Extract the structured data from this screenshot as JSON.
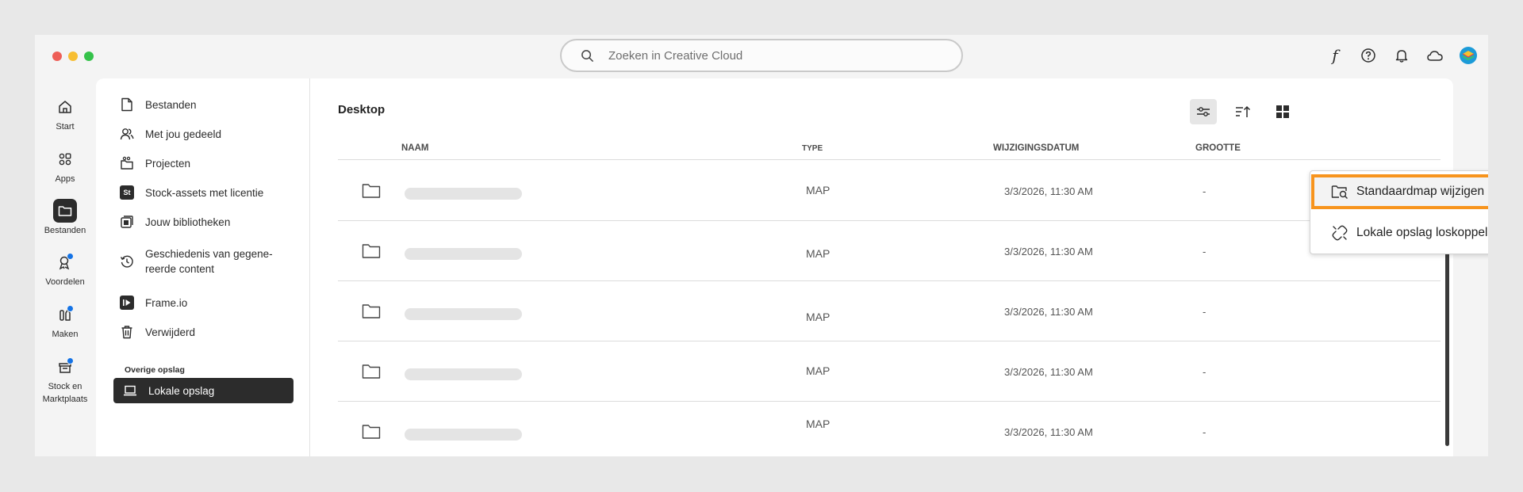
{
  "search": {
    "placeholder": "Zoeken in Creative Cloud"
  },
  "topbar": {
    "icons": [
      "fonts-icon",
      "help-icon",
      "bell-icon",
      "cloud-icon",
      "creative-cloud-avatar-icon"
    ],
    "font_glyph": "f"
  },
  "rail": {
    "items": [
      {
        "label": "Start",
        "icon": "home-icon"
      },
      {
        "label": "Apps",
        "icon": "apps-grid-icon"
      },
      {
        "label": "Bestanden",
        "icon": "folder-icon"
      },
      {
        "label": "Voordelen",
        "icon": "rewards-icon"
      },
      {
        "label": "Maken",
        "icon": "create-icon"
      },
      {
        "label": "Stock en",
        "label2": "Marktplaats",
        "icon": "marketplace-icon"
      }
    ]
  },
  "sidenav": {
    "items": [
      {
        "label": "Bestanden",
        "icon": "file-icon"
      },
      {
        "label": "Met jou gedeeld",
        "icon": "shared-users-icon"
      },
      {
        "label": "Projecten",
        "icon": "projects-icon"
      },
      {
        "label": "Stock-assets met licentie",
        "icon": "stock-icon",
        "glyph": "St"
      },
      {
        "label": "Jouw bibliotheken",
        "icon": "libraries-icon"
      },
      {
        "label": "Geschiedenis van gegene-",
        "label2": "reerde content",
        "icon": "history-icon"
      },
      {
        "label": "Frame.io",
        "icon": "frameio-icon"
      },
      {
        "label": "Verwijderd",
        "icon": "trash-icon"
      }
    ],
    "section_title": "Overige opslag",
    "active_item": {
      "label": "Lokale opslag",
      "icon": "laptop-icon"
    }
  },
  "content": {
    "title": "Desktop",
    "columns": {
      "name": "NAAM",
      "type": "TYPE",
      "date": "WIJZIGINGSDATUM",
      "size": "GROOTTE"
    },
    "rows": [
      {
        "type": "MAP",
        "date": "3/3/2026, 11:30 AM",
        "size": "-"
      },
      {
        "type": "MAP",
        "date": "3/3/2026, 11:30 AM",
        "size": "-"
      },
      {
        "type": "MAP",
        "date": "3/3/2026, 11:30 AM",
        "size": "-"
      },
      {
        "type": "MAP",
        "date": "3/3/2026, 11:30 AM",
        "size": "-"
      },
      {
        "type": "MAP",
        "date": "3/3/2026, 11:30 AM",
        "size": "-"
      }
    ]
  },
  "menu": {
    "items": [
      {
        "label": "Standaardmap wijzigen",
        "icon": "folder-search-icon",
        "highlighted": true
      },
      {
        "label": "Lokale opslag loskoppelen",
        "icon": "unlink-icon",
        "highlighted": false
      }
    ],
    "highlight_color": "#f7941d"
  },
  "colors": {
    "accent": "#1473e6",
    "active_bg": "#2c2c2c"
  }
}
